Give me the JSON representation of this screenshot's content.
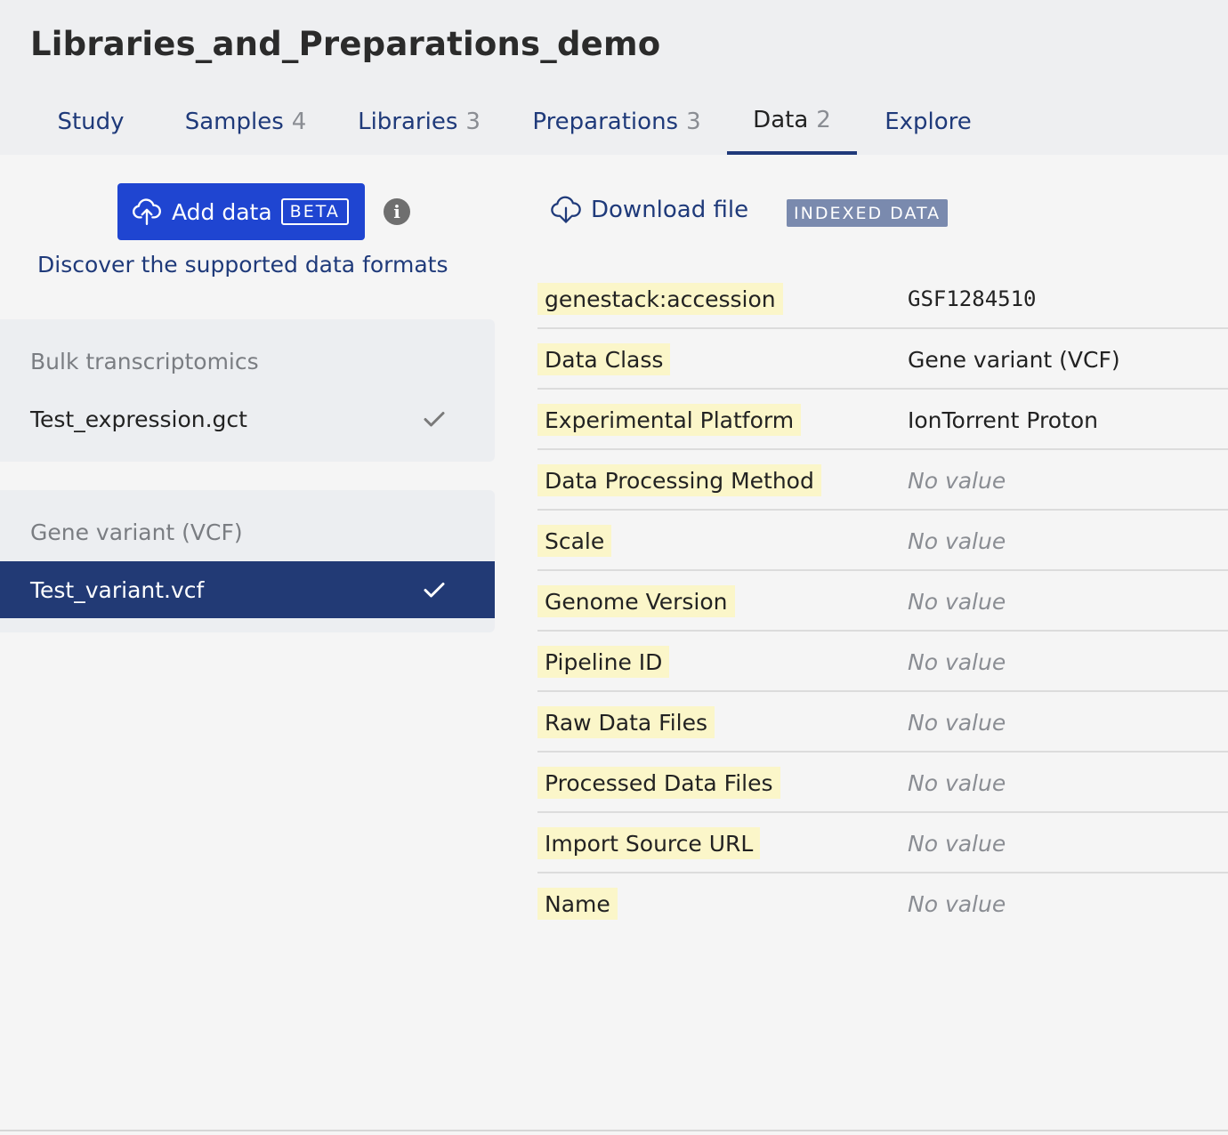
{
  "title": "Libraries_and_Preparations_demo",
  "tabs": [
    {
      "label": "Study",
      "count": ""
    },
    {
      "label": "Samples",
      "count": "4"
    },
    {
      "label": "Libraries",
      "count": "3"
    },
    {
      "label": "Preparations",
      "count": "3"
    },
    {
      "label": "Data",
      "count": "2"
    },
    {
      "label": "Explore",
      "count": ""
    }
  ],
  "active_tab": "Data",
  "sidebar": {
    "add_label": "Add data",
    "beta_label": "BETA",
    "info_icon": "i",
    "formats_link": "Discover the supported data formats",
    "groups": [
      {
        "title": "Bulk transcriptomics",
        "items": [
          {
            "name": "Test_expression.gct",
            "selected": false
          }
        ]
      },
      {
        "title": "Gene variant (VCF)",
        "items": [
          {
            "name": "Test_variant.vcf",
            "selected": true
          }
        ]
      }
    ]
  },
  "main": {
    "download_label": "Download file",
    "indexed_badge": "INDEXED DATA",
    "metadata": [
      {
        "key": "genestack:accession",
        "value": "GSF1284510"
      },
      {
        "key": "Data Class",
        "value": "Gene variant (VCF)"
      },
      {
        "key": "Experimental Platform",
        "value": "IonTorrent Proton"
      },
      {
        "key": "Data Processing Method",
        "value": "No value"
      },
      {
        "key": "Scale",
        "value": "No value"
      },
      {
        "key": "Genome Version",
        "value": "No value"
      },
      {
        "key": "Pipeline ID",
        "value": "No value"
      },
      {
        "key": "Raw Data Files",
        "value": "No value"
      },
      {
        "key": "Processed Data Files",
        "value": "No value"
      },
      {
        "key": "Import Source URL",
        "value": "No value"
      },
      {
        "key": "Name",
        "value": "No value"
      }
    ]
  },
  "colors": {
    "primary_button": "#1f45d1",
    "selected_item": "#223a75",
    "link": "#1f3a7a",
    "key_highlight": "#fbf6c9",
    "indexed_badge": "#7a8aae"
  }
}
